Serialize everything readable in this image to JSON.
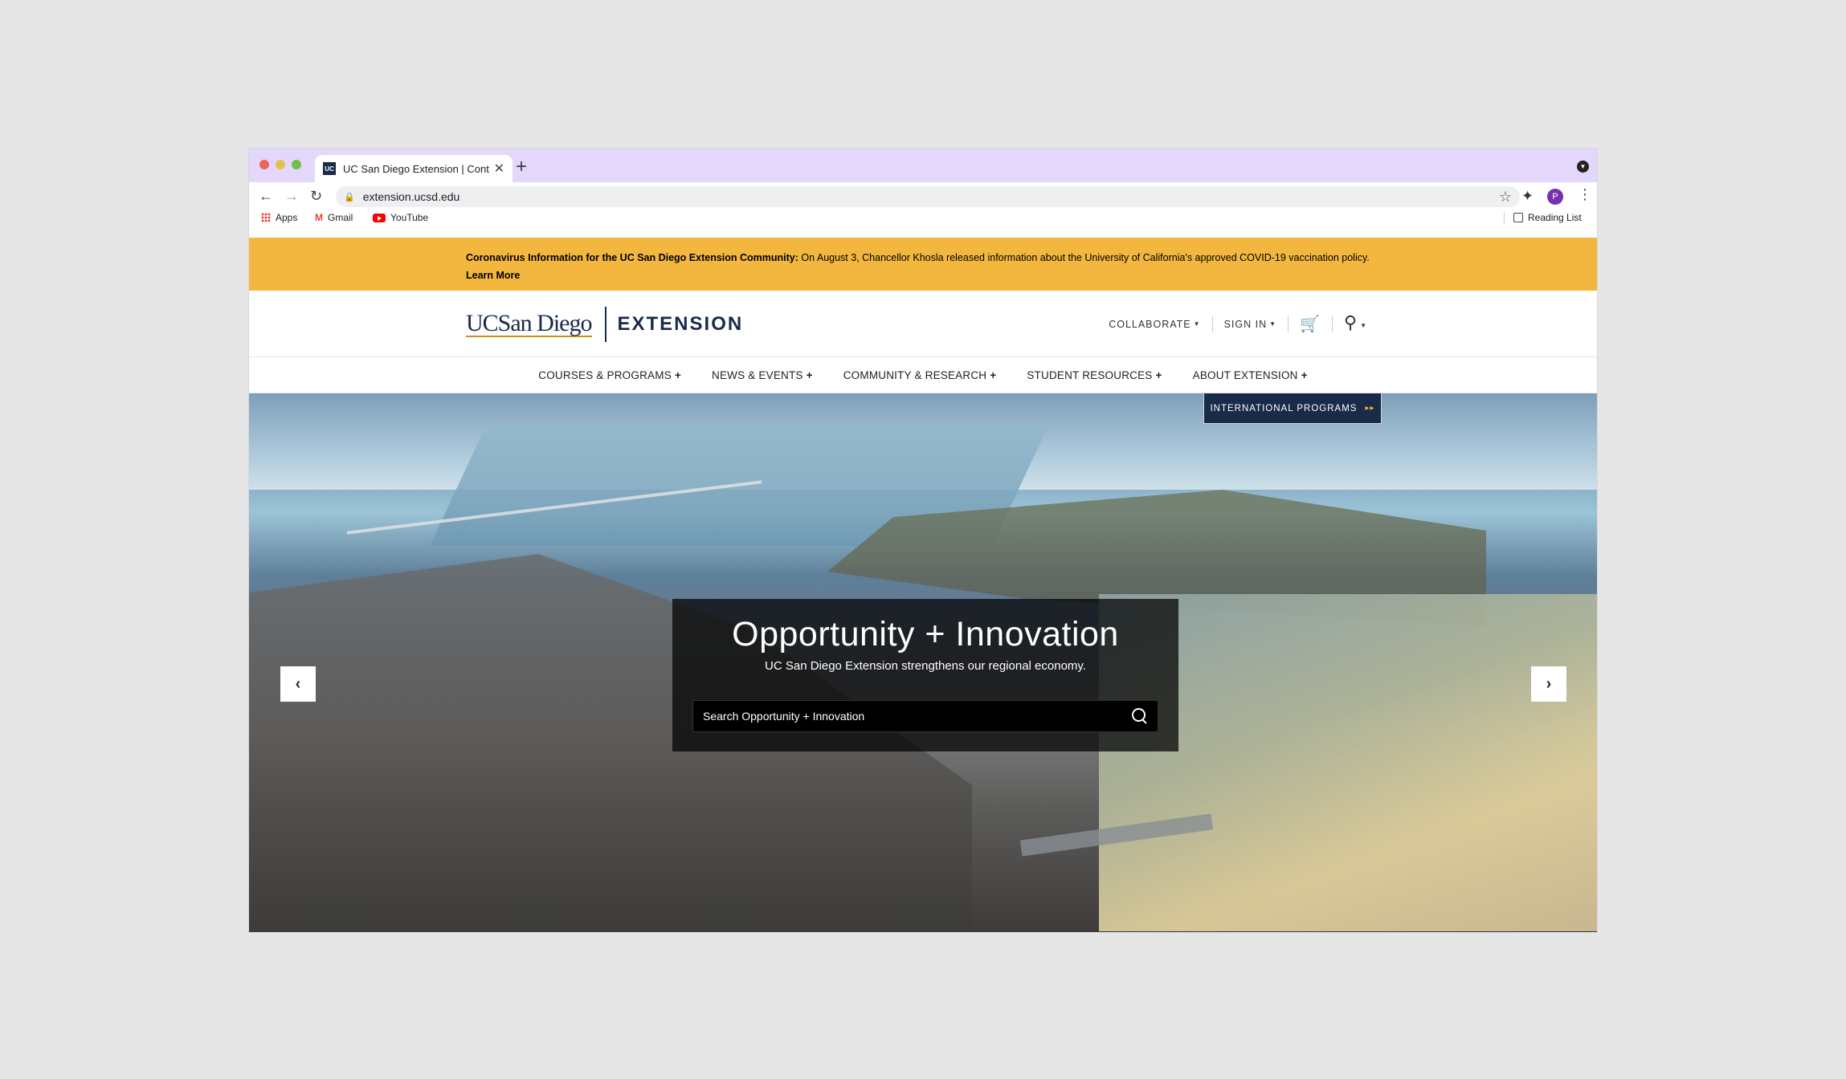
{
  "browser": {
    "tab_title": "UC San Diego Extension | Cont",
    "tab_favicon": "UC",
    "new_tab": "+",
    "url": "extension.ucsd.edu",
    "avatar_letter": "P",
    "bookmarks": [
      {
        "label": "Apps",
        "icon": "apps-grid-icon"
      },
      {
        "label": "Gmail",
        "icon": "gmail-icon"
      },
      {
        "label": "YouTube",
        "icon": "youtube-icon"
      }
    ],
    "reading_list": "Reading List"
  },
  "alert": {
    "bold_lead": "Coronavirus Information for the UC San Diego Extension Community:",
    "body": " On August 3, Chancellor Khosla released information about the University of California's approved COVID-19 vaccination policy. ",
    "link": "Learn More",
    "bg_color": "#f3b73f"
  },
  "header": {
    "logo_uc": "UCSan Diego",
    "logo_ext": "EXTENSION",
    "util": {
      "collaborate": "COLLABORATE",
      "sign_in": "SIGN IN"
    }
  },
  "nav": {
    "items": [
      {
        "label": "COURSES & PROGRAMS"
      },
      {
        "label": "NEWS & EVENTS"
      },
      {
        "label": "COMMUNITY & RESEARCH"
      },
      {
        "label": "STUDENT RESOURCES"
      },
      {
        "label": "ABOUT EXTENSION"
      }
    ],
    "plus": "+"
  },
  "hero": {
    "title": "Opportunity + Innovation",
    "subtitle": "UC San Diego Extension strengthens our regional economy.",
    "search_placeholder": "Search Opportunity + Innovation",
    "intl_button": "INTERNATIONAL PROGRAMS",
    "intl_arrows": "▸▸"
  },
  "colors": {
    "brand_navy": "#182b49",
    "brand_gold": "#f3b73f",
    "tabstrip": "#e3d7fb"
  }
}
